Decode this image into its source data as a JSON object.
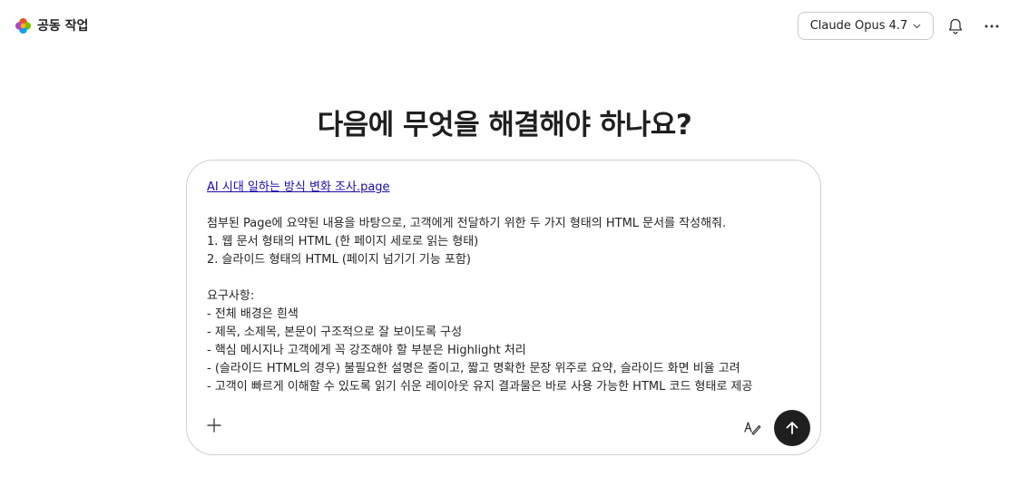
{
  "header": {
    "app_title": "공동 작업",
    "model_label": "Claude Opus 4.7"
  },
  "main": {
    "headline": "다음에 무엇을 해결해야 하나요?"
  },
  "composer": {
    "attachment_link": "AI 시대 일하는 방식 변화 조사.page",
    "lines": [
      "첨부된 Page에 요약된 내용을 바탕으로, 고객에게 전달하기 위한 두 가지 형태의 HTML 문서를 작성해줘.",
      "1. 웹 문서 형태의 HTML (한 페이지 세로로 읽는 형태)",
      "2. 슬라이드 형태의 HTML (페이지 넘기기 기능 포함)",
      "",
      "요구사항:",
      "- 전체 배경은 흰색",
      "- 제목, 소제목, 본문이 구조적으로 잘 보이도록 구성",
      "- 핵심 메시지나 고객에게 꼭 강조해야 할 부분은 Highlight 처리",
      "- (슬라이드 HTML의 경우) 불필요한 설명은 줄이고, 짧고 명확한 문장 위주로 요약, 슬라이드 화면 비율 고려",
      "- 고객이 빠르게 이해할 수 있도록 읽기 쉬운 레이아웃 유지 결과물은 바로 사용 가능한 HTML 코드 형태로 제공"
    ]
  },
  "icons": {
    "logo": "colorful-flower-logo-icon",
    "model_dropdown": "chevron-down-icon",
    "notifications": "bell-icon",
    "more": "more-horizontal-icon",
    "add": "plus-icon",
    "format": "text-format-pen-icon",
    "send": "arrow-up-icon"
  },
  "colors": {
    "send_button": "#1f1f1f",
    "link": "#1a0dab",
    "border": "#cfcfcf"
  }
}
